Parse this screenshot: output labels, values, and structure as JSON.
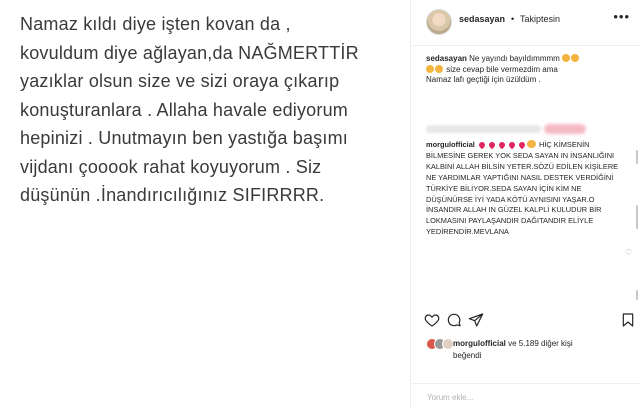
{
  "post": {
    "text": "Namaz kıldı diye işten kovan da ,\nkovuldum diye ağlayan,da NAĞMERTTİR\nyazıklar olsun size ve sizi oraya çıkarıp\nkonuşturanlara . Allaha havale ediyorum\nhepinizi . Unutmayın ben yastığa başımı\nvijdanı çooook rahat koyuyorum . Siz\ndüşünün .İnandırıcılığınız SIFIRRRR."
  },
  "header": {
    "username": "sedasayan",
    "dot": "•",
    "follow_status": "Takiptesin",
    "more": "•••"
  },
  "caption": {
    "username": "sedasayan",
    "text_line1": " Ne yayındı bayıldımmmm",
    "text_line2": " size cevap bile vermezdim ama",
    "text_line3": "Namaz lafı geçtiği için üzüldüm ."
  },
  "comment": {
    "username": "morgulofficial",
    "text": "HİÇ KİMSENİN BİLMESİNE GEREK YOK SEDA SAYAN IN İNSANLIĞINI KALBİNİ ALLAH BİLSİN YETER.SÖZÜ EDİLEN KİŞİLERE NE YARDIMLAR YAPTIĞINI NASIL DESTEK VERDİĞİNİ TÜRKİYE BİLİYOR.SEDA SAYAN İÇİN KİM NE DÜŞÜNÜRSE İYİ YADA KÖTÜ AYNISINI YAŞAR.O İNSANDIR ALLAH IN GÜZEL KALPLİ KULUDUR BİR LOKMASINI PAYLAŞANDIR DAĞITANDIR ELİYLE YEDİRENDİR.MEVLANA"
  },
  "likes": {
    "user": "morgulofficial",
    "rest": " ve 5.189 diğer kişi",
    "line2": "beğendi"
  },
  "add_comment_placeholder": "Yorum ekle...",
  "colors": {
    "heart": "#e0245e",
    "clap": "#f3b53f"
  }
}
